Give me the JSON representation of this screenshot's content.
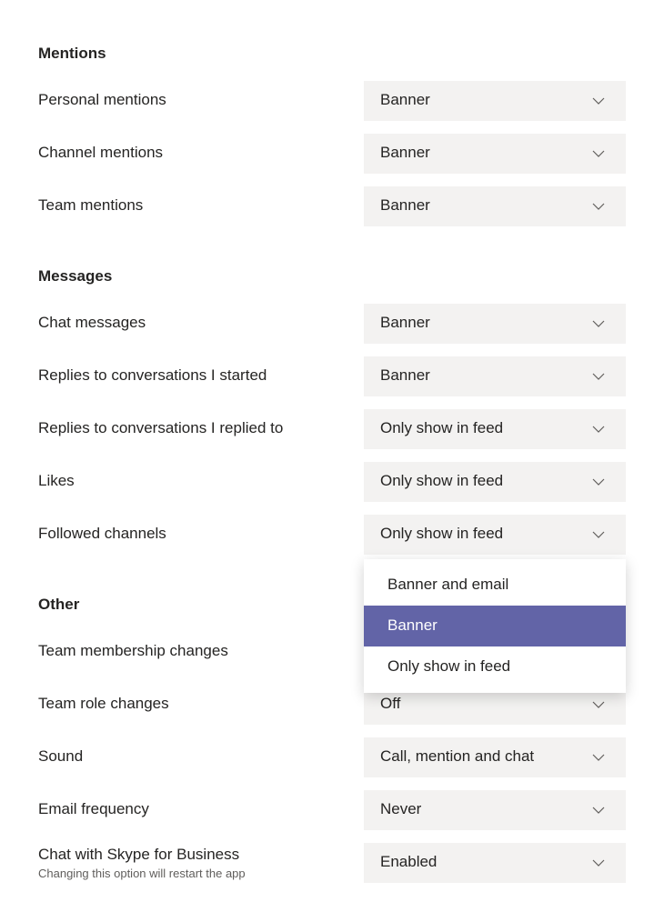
{
  "sections": {
    "mentions": {
      "title": "Mentions",
      "rows": [
        {
          "label": "Personal mentions",
          "value": "Banner"
        },
        {
          "label": "Channel mentions",
          "value": "Banner"
        },
        {
          "label": "Team mentions",
          "value": "Banner"
        }
      ]
    },
    "messages": {
      "title": "Messages",
      "rows": [
        {
          "label": "Chat messages",
          "value": "Banner"
        },
        {
          "label": "Replies to conversations I started",
          "value": "Banner"
        },
        {
          "label": "Replies to conversations I replied to",
          "value": "Only show in feed"
        },
        {
          "label": "Likes",
          "value": "Only show in feed"
        },
        {
          "label": "Followed channels",
          "value": "Only show in feed",
          "open": true
        }
      ],
      "open_options": [
        "Banner and email",
        "Banner",
        "Only show in feed"
      ],
      "open_selected": "Banner"
    },
    "other": {
      "title": "Other",
      "rows": [
        {
          "label": "Team membership changes",
          "value": ""
        },
        {
          "label": "Team role changes",
          "value": "Off"
        },
        {
          "label": "Sound",
          "value": "Call, mention and chat"
        },
        {
          "label": "Email frequency",
          "value": "Never"
        },
        {
          "label": "Chat with Skype for Business",
          "sublabel": "Changing this option will restart the app",
          "value": "Enabled"
        }
      ]
    }
  }
}
